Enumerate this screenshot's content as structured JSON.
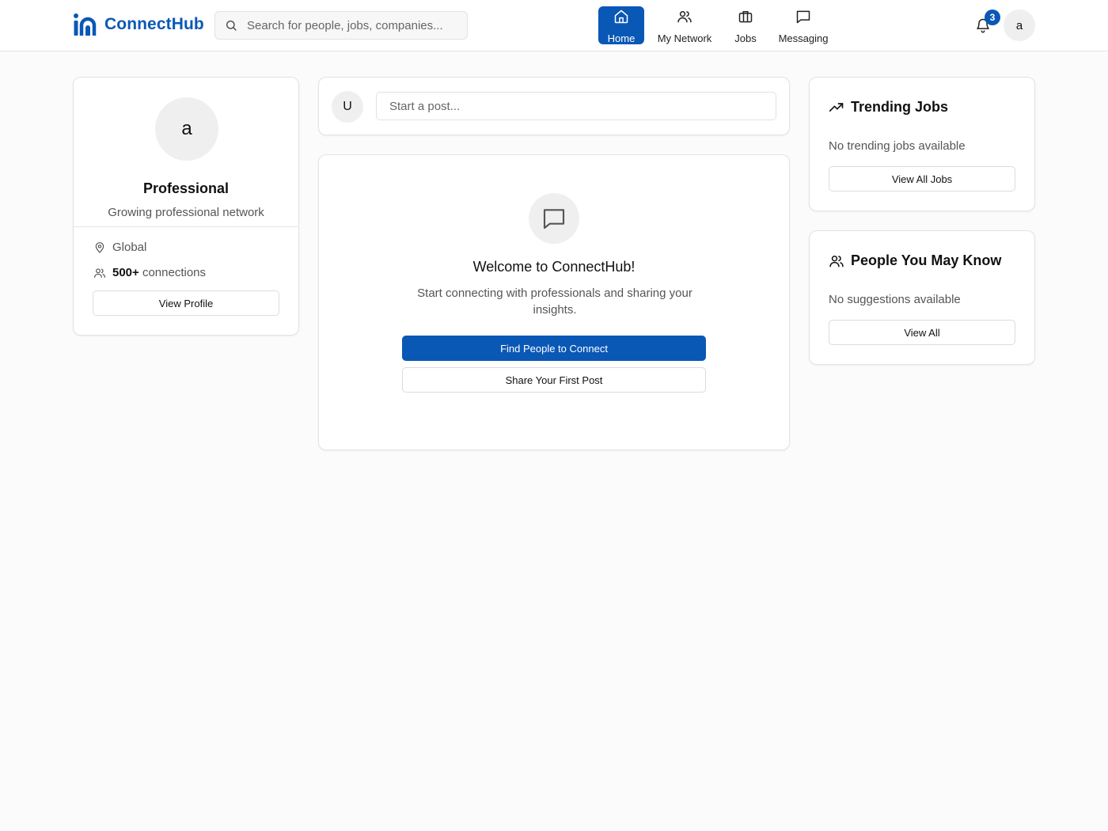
{
  "header": {
    "brand_name": "ConnectHub",
    "brand_color": "#0a58b6",
    "search_placeholder": "Search for people, jobs, companies...",
    "nav": [
      {
        "label": "Home",
        "icon": "home-icon",
        "active": true
      },
      {
        "label": "My Network",
        "icon": "users-icon",
        "active": false
      },
      {
        "label": "Jobs",
        "icon": "briefcase-icon",
        "active": false
      },
      {
        "label": "Messaging",
        "icon": "message-square-icon",
        "active": false
      }
    ],
    "notifications_count": "3",
    "avatar_initial": "a"
  },
  "profile": {
    "avatar_initial": "a",
    "name": "Professional",
    "tagline": "Growing professional network",
    "location": "Global",
    "connections_count": "500+",
    "connections_label": "connections",
    "view_profile_label": "View Profile"
  },
  "composer": {
    "avatar_initial": "U",
    "placeholder": "Start a post..."
  },
  "welcome": {
    "title": "Welcome to ConnectHub!",
    "text": "Start connecting with professionals and sharing your insights.",
    "primary_button": "Find People to Connect",
    "secondary_button": "Share Your First Post"
  },
  "trending_jobs": {
    "title": "Trending Jobs",
    "empty_text": "No trending jobs available",
    "button": "View All Jobs"
  },
  "people_you_may_know": {
    "title": "People You May Know",
    "empty_text": "No suggestions available",
    "button": "View All"
  }
}
